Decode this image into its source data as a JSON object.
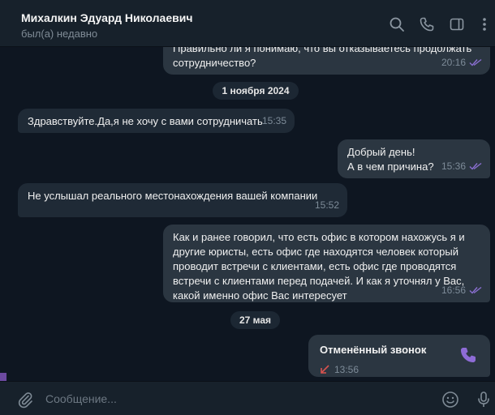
{
  "header": {
    "name": "Михалкин Эдуард Николаевич",
    "status": "был(а) недавно"
  },
  "messages": [
    {
      "dir": "out",
      "text": "Правильно ли я понимаю, что вы отказываетесь продолжать\nсотрудничество?",
      "time": "20:16",
      "read": true
    },
    {
      "dir": "in",
      "text": "Здравствуйте.Да,я не хочу с вами сотрудничать",
      "time": "15:35"
    },
    {
      "dir": "out",
      "text": "Добрый день!\nА в чем причина?",
      "time": "15:36",
      "read": true
    },
    {
      "dir": "in",
      "text": "Не услышал реального местонахождения вашей компании",
      "time": "15:52"
    },
    {
      "dir": "out",
      "text": "Как и ранее говорил, что есть офис в котором нахожусь я и\nдругие юристы, есть офис где находятся человек который\nпроводит встречи с клиентами, есть офис где проводятся\nвстречи с клиентами перед подачей. И как я уточнял у Вас,\nкакой именно офис Вас интересует",
      "time": "16:56",
      "read": true
    }
  ],
  "dates": [
    "1 ноября 2024",
    "27 мая"
  ],
  "call": {
    "title": "Отменённый звонок",
    "time": "13:56"
  },
  "composer": {
    "placeholder": "Сообщение..."
  },
  "colors": {
    "accent": "#8e6cd6",
    "missed": "#d9534f",
    "check": "#8a6fd1"
  },
  "icons": [
    "search-icon",
    "phone-icon",
    "sidebar-toggle-icon",
    "more-icon",
    "attach-icon",
    "emoji-icon",
    "mic-icon"
  ]
}
